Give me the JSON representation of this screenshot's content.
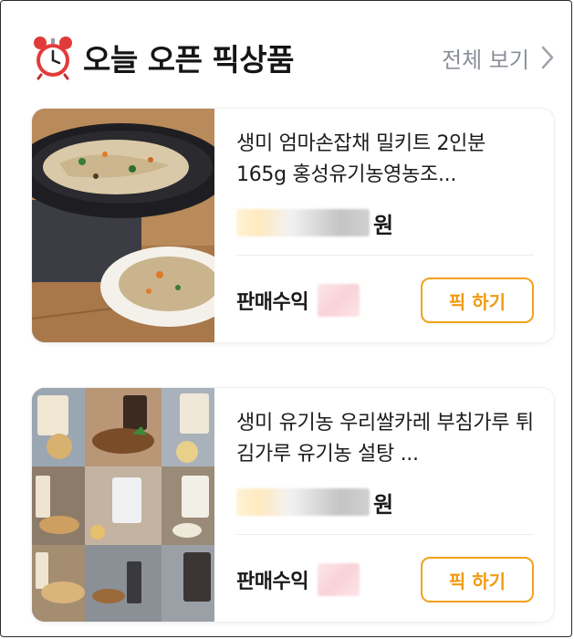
{
  "header": {
    "icon": "alarm-clock-icon",
    "title": "오늘 오픈 픽상품",
    "see_all_label": "전체 보기"
  },
  "colors": {
    "accent": "#f3a21b",
    "muted_text": "#8a8f98",
    "title_text": "#151515"
  },
  "products": [
    {
      "name": "생미 엄마손잡채 밀키트 2인분 165g 홍성유기농영농조...",
      "price_currency": "원",
      "profit_label": "판매수익",
      "pick_label": "픽 하기"
    },
    {
      "name": "생미 유기농 우리쌀카레 부침가루 튀김가루 유기농 설탕 ...",
      "price_currency": "원",
      "profit_label": "판매수익",
      "pick_label": "픽 하기"
    }
  ]
}
